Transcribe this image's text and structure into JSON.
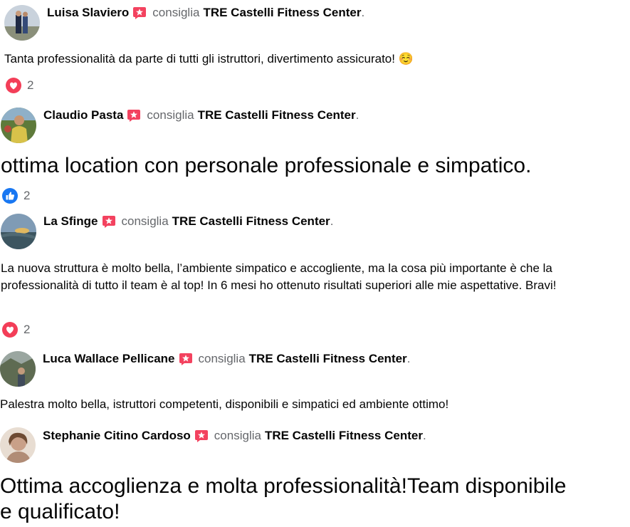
{
  "recommend_word": "consiglia",
  "page_name": "TRE Castelli Fitness Center",
  "period": ".",
  "reviews": [
    {
      "name": "Luisa Slaviero",
      "text": "Tanta professionalità da parte di tutti gli istruttori, divertimento assicurato! ☺️",
      "reaction_icon": "heart-icon",
      "reaction_count": "2"
    },
    {
      "name": "Claudio Pasta",
      "text": "ottima location con personale professionale e simpatico.",
      "reaction_icon": "like-icon",
      "reaction_count": "2"
    },
    {
      "name": "La Sfinge",
      "text": "La nuova struttura è molto bella, l’ambiente simpatico e accogliente, ma la cosa più importante è che la professionalità di tutto il team è al top! In 6 mesi ho ottenuto risultati superiori alle mie aspettative. Bravi!",
      "reaction_icon": "heart-icon",
      "reaction_count": "2"
    },
    {
      "name": "Luca Wallace Pellicane",
      "text": "Palestra molto bella, istruttori competenti, disponibili e simpatici ed ambiente ottimo!"
    },
    {
      "name": "Stephanie Citino Cardoso",
      "text": "Ottima accoglienza e molta professionalità!Team disponibile e qualificato!"
    }
  ],
  "colors": {
    "badge": "#f3425f",
    "heart": "#f33e58",
    "like": "#1877f2",
    "secondary_text": "#65676b"
  }
}
